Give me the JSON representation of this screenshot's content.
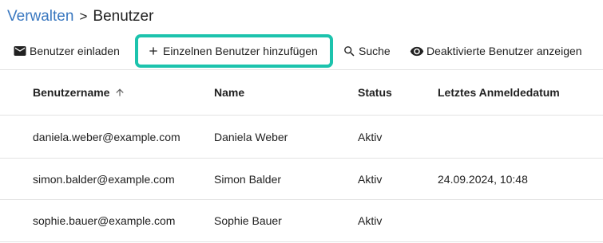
{
  "breadcrumb": {
    "parent": "Verwalten",
    "separator": ">",
    "current": "Benutzer"
  },
  "toolbar": {
    "invite_label": "Benutzer einladen",
    "add_single_label": "Einzelnen Benutzer hinzufügen",
    "search_label": "Suche",
    "show_deactivated_label": "Deaktivierte Benutzer anzeigen",
    "highlight_color": "#1cc3ad"
  },
  "table": {
    "columns": [
      "Benutzername",
      "Name",
      "Status",
      "Letztes Anmeldedatum"
    ],
    "sorted_column": "Benutzername",
    "sort_direction": "ascending",
    "rows": [
      {
        "username": "daniela.weber@example.com",
        "name": "Daniela Weber",
        "status": "Aktiv",
        "last_login": ""
      },
      {
        "username": "simon.balder@example.com",
        "name": "Simon Balder",
        "status": "Aktiv",
        "last_login": "24.09.2024, 10:48"
      },
      {
        "username": "sophie.bauer@example.com",
        "name": "Sophie Bauer",
        "status": "Aktiv",
        "last_login": ""
      }
    ]
  },
  "colors": {
    "link": "#3a78c0",
    "text": "#212121",
    "divider": "#e3e3e3"
  }
}
